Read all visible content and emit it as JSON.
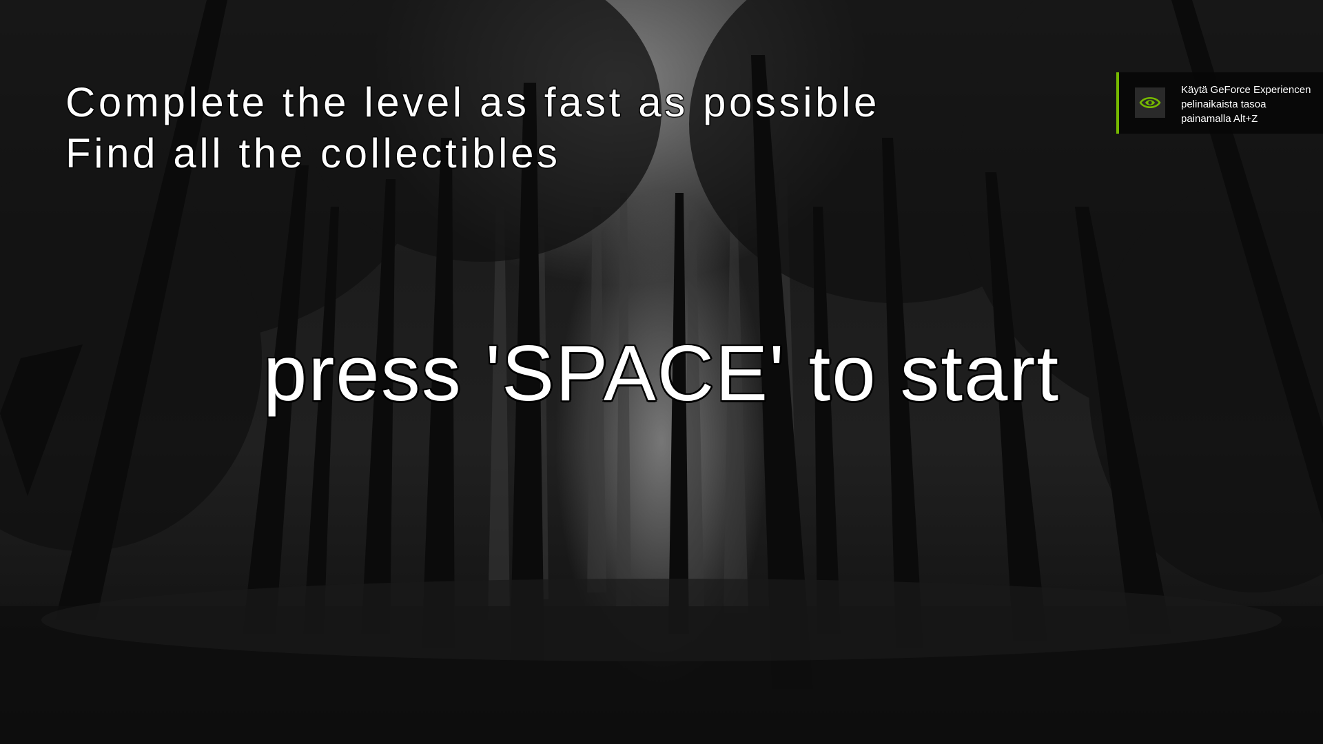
{
  "objectives": [
    "Complete the level as fast as possible",
    "Find all the collectibles"
  ],
  "start_prompt": "press 'SPACE' to start",
  "notification": {
    "lines": [
      "Käytä GeForce Experiencen",
      "pelinaikaista tasoa",
      "painamalla Alt+Z"
    ],
    "icon": "nvidia-eye-logo",
    "accent_color": "#76b900"
  },
  "background": {
    "scene": "dark-forest-icon",
    "palette": [
      "#000000",
      "#1c1c1c",
      "#bdbdbd"
    ]
  }
}
